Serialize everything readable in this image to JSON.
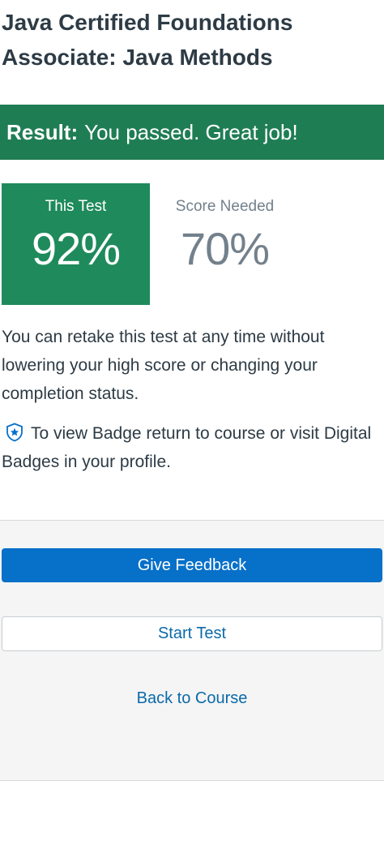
{
  "header": {
    "title_line1": "Java Certified Foundations",
    "title_line2": "Associate: Java Methods"
  },
  "result": {
    "label": "Result:",
    "message": "You passed. Great job!",
    "color": "#1f7d54"
  },
  "scores": {
    "this_test_label": "This Test",
    "this_test_value": "92%",
    "needed_label": "Score Needed",
    "needed_value": "70%"
  },
  "info": {
    "retake_text": "You can retake this test at any time without lowering your high score or changing your completion status.",
    "badge_icon": "badge-star-icon",
    "badge_text": "To view Badge return to course or visit Digital Badges in your profile."
  },
  "actions": {
    "feedback_label": "Give Feedback",
    "start_label": "Start Test",
    "back_label": "Back to Course",
    "primary_color": "#0770c9",
    "link_color": "#0b6aa8"
  }
}
